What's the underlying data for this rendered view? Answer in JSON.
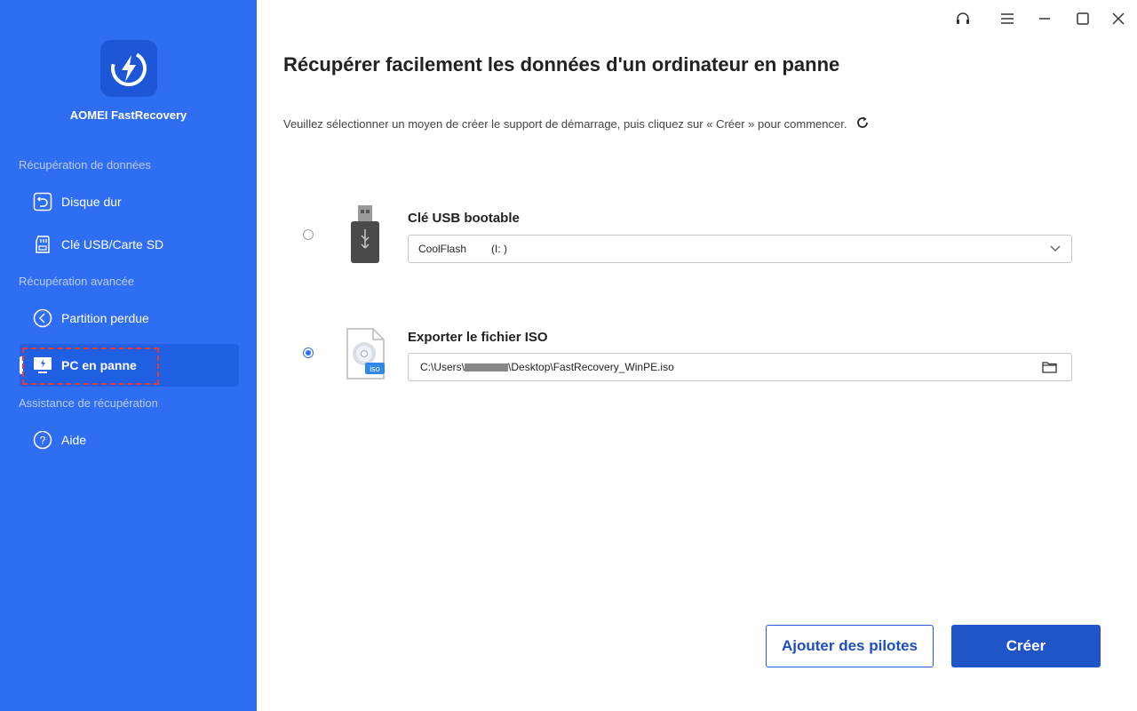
{
  "app": {
    "name": "AOMEI FastRecovery"
  },
  "sidebar": {
    "sections": [
      {
        "label": "Récupération de données"
      },
      {
        "label": "Récupération avancée"
      },
      {
        "label": "Assistance de récupération"
      }
    ],
    "items": [
      {
        "label": "Disque dur",
        "icon": "restore-icon"
      },
      {
        "label": "Clé USB/Carte SD",
        "icon": "sd-card-icon"
      },
      {
        "label": "Partition perdue",
        "icon": "partition-icon"
      },
      {
        "label": "PC en panne",
        "icon": "crashed-pc-icon",
        "active": true
      },
      {
        "label": "Aide",
        "icon": "help-icon"
      }
    ]
  },
  "window_controls": [
    "headset-icon",
    "menu-icon",
    "minimize-icon",
    "maximize-icon",
    "close-icon"
  ],
  "main": {
    "title": "Récupérer facilement les données d'un ordinateur en panne",
    "subtitle": "Veuillez sélectionner un moyen de créer le support de démarrage, puis cliquez sur « Créer » pour commencer.",
    "options": [
      {
        "title": "Clé USB bootable",
        "icon": "usb-drive-icon",
        "selected": false,
        "field": {
          "name": "CoolFlash",
          "drive": "(I: )",
          "control": "chevron-down-icon"
        }
      },
      {
        "title": "Exporter le fichier ISO",
        "icon": "iso-file-icon",
        "selected": true,
        "field": {
          "path_prefix": "C:\\Users\\",
          "path_suffix": "\\Desktop\\FastRecovery_WinPE.iso",
          "control": "folder-icon"
        }
      }
    ],
    "iso_badge": "iso"
  },
  "buttons": {
    "add_drivers": "Ajouter des pilotes",
    "create": "Créer"
  },
  "colors": {
    "sidebar": "#2f6ef2",
    "primary": "#1f55c7",
    "highlight": "#e53935"
  }
}
